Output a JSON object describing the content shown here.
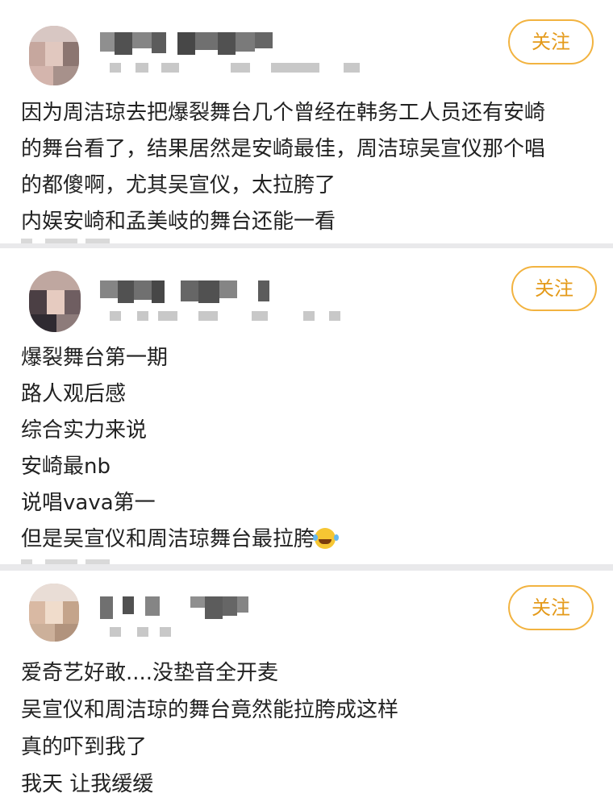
{
  "posts": [
    {
      "follow_label": "关注",
      "lines": [
        "因为周洁琼去把爆裂舞台几个曾经在韩务工人员还有安崎",
        "的舞台看了，结果居然是安崎最佳，周洁琼吴宣仪那个唱",
        "的都傻啊，尤其吴宣仪，太拉胯了",
        "内娱安崎和孟美岐的舞台还能一看"
      ]
    },
    {
      "follow_label": "关注",
      "lines": [
        "爆裂舞台第一期",
        "路人观后感",
        "综合实力来说",
        "安崎最nb",
        "说唱vava第一",
        "但是吴宣仪和周洁琼舞台最拉胯"
      ],
      "last_line_icon": "laughing-crying-emoji-icon"
    },
    {
      "follow_label": "关注",
      "lines": [
        "爱奇艺好敢....没垫音全开麦",
        "吴宣仪和周洁琼的舞台竟然能拉胯成这样",
        "真的吓到我了",
        "我天 让我缓缓"
      ]
    }
  ],
  "colors": {
    "follow_text": "#e49a1a",
    "follow_border": "#f2b340",
    "text": "#222222",
    "separator": "#e9e9eb"
  },
  "icons": {
    "avatar": "blurred-avatar-image",
    "username": "blurred-username",
    "meta": "blurred-timestamp"
  }
}
